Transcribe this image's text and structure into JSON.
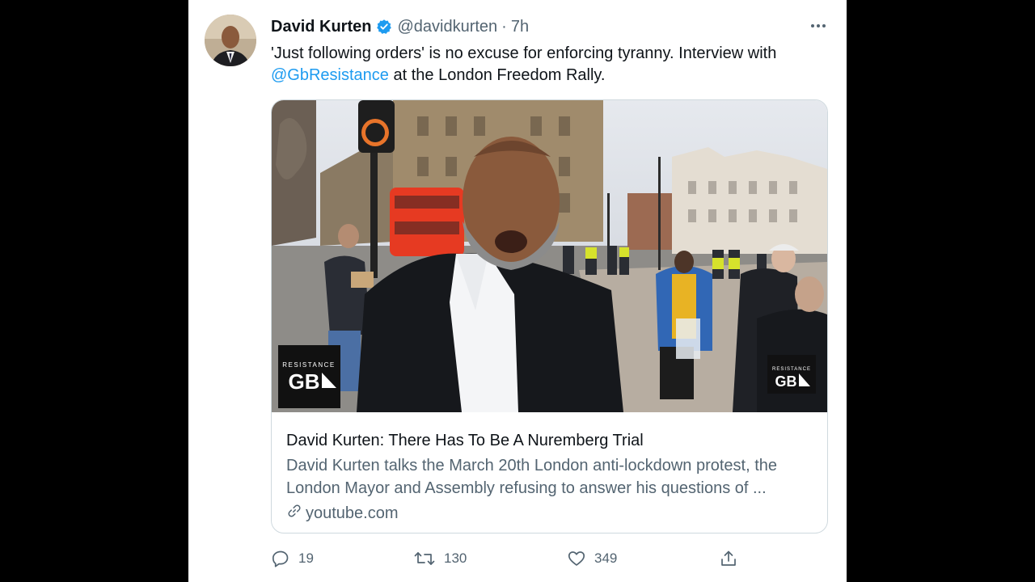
{
  "tweet": {
    "author_name": "David Kurten",
    "handle": "@davidkurten",
    "separator": "·",
    "time": "7h",
    "text_before": "'Just following orders' is no excuse for enforcing tyranny. Interview with ",
    "mention": "@GbResistance",
    "text_after": " at the London Freedom Rally."
  },
  "card": {
    "watermark_top": "RESISTANCE",
    "watermark_main": "GB",
    "title": "David Kurten: There Has To Be A Nuremberg Trial",
    "description": "David Kurten talks the March 20th London anti-lockdown protest, the London Mayor and Assembly refusing to answer his questions of ...",
    "domain": "youtube.com"
  },
  "actions": {
    "reply_count": "19",
    "retweet_count": "130",
    "like_count": "349"
  },
  "colors": {
    "accent": "#1d9bf0",
    "text_primary": "#0f1419",
    "text_secondary": "#536471",
    "bus_red": "#e63a22"
  }
}
